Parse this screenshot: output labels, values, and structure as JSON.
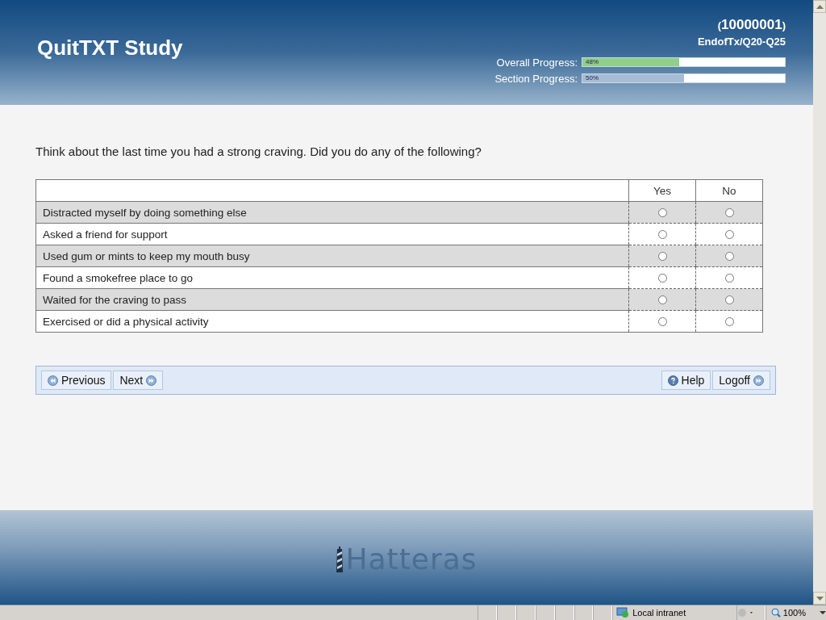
{
  "header": {
    "title": "QuitTXT Study",
    "participant_id": {
      "open": "(",
      "value": "10000001",
      "close": ")"
    },
    "section": "EndofTx/Q20-Q25",
    "progress": [
      {
        "label": "Overall Progress:",
        "level": 0.48,
        "reading": "48%",
        "color": "#8fcf8a"
      },
      {
        "label": "Section Progress:",
        "level": 0.5,
        "reading": "50%",
        "color": "#a7bdd6"
      }
    ]
  },
  "question": "Think about the last time you had a strong craving. Did you do any of the following?",
  "table": {
    "columns": [
      "Yes",
      "No"
    ],
    "rows": [
      {
        "label": "Distracted myself by doing something else",
        "answers": [
          {
            "selected": false
          },
          {
            "selected": false
          }
        ]
      },
      {
        "label": "Asked a friend for support",
        "answers": [
          {
            "selected": false
          },
          {
            "selected": false
          }
        ]
      },
      {
        "label": "Used gum or mints to keep my mouth busy",
        "answers": [
          {
            "selected": false
          },
          {
            "selected": false
          }
        ]
      },
      {
        "label": "Found a smokefree place to go",
        "answers": [
          {
            "selected": false
          },
          {
            "selected": false
          }
        ]
      },
      {
        "label": "Waited for the craving to pass",
        "answers": [
          {
            "selected": false
          },
          {
            "selected": false
          }
        ]
      },
      {
        "label": "Exercised or did a physical activity",
        "answers": [
          {
            "selected": false
          },
          {
            "selected": false
          }
        ]
      }
    ]
  },
  "nav": {
    "left": [
      {
        "label": "Previous",
        "kind": "back"
      },
      {
        "label": "Next",
        "kind": "forward"
      }
    ],
    "right": [
      {
        "label": "Help",
        "kind": "help"
      },
      {
        "label": "Logoff",
        "kind": "forward"
      }
    ]
  },
  "footer": {
    "logo": "Hatteras"
  },
  "status_bar": {
    "zone": "Local intranet",
    "zoom": "100%"
  }
}
